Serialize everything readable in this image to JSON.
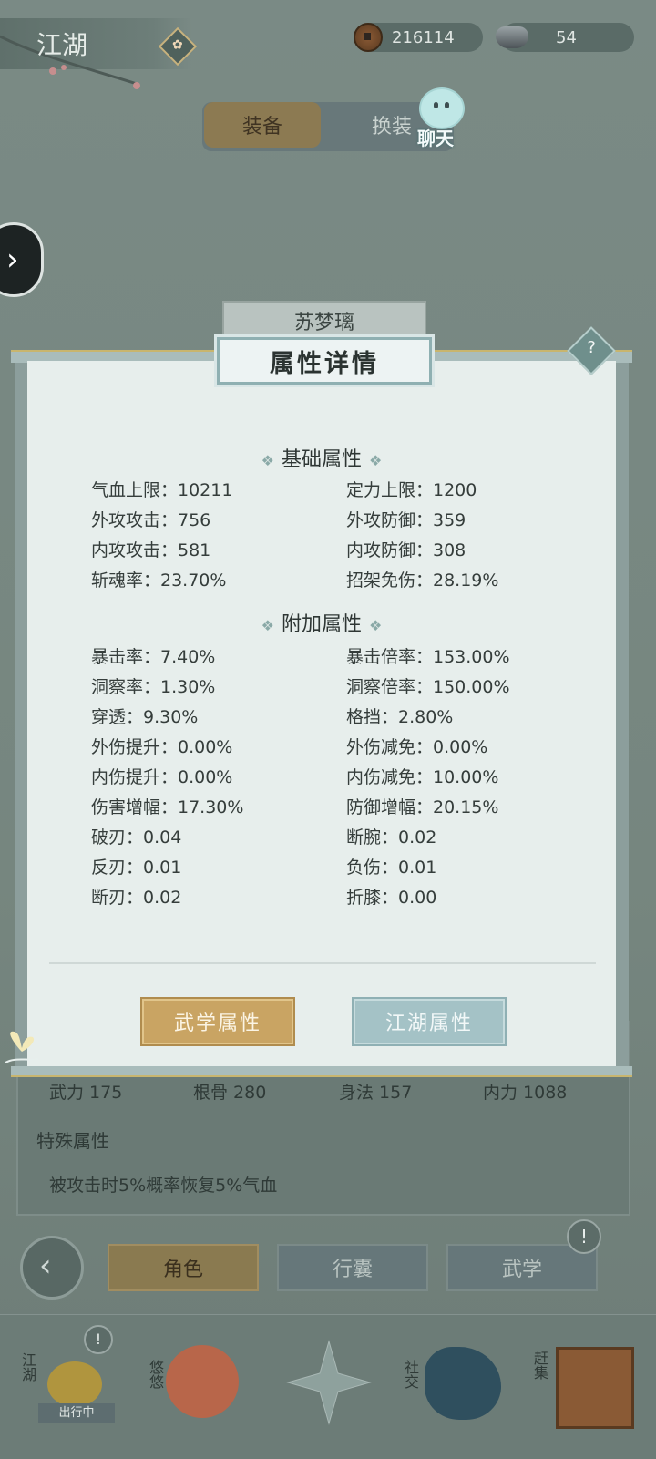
{
  "header": {
    "title": "江湖",
    "hint_icon": "hint-diamond-icon",
    "coins": "216114",
    "ingots": "54"
  },
  "top_tabs": {
    "equip": "装备",
    "change_outfit": "换装",
    "chat": "聊天"
  },
  "modal": {
    "character_name": "苏梦璃",
    "title": "属性详情",
    "help": "?",
    "basic": {
      "heading": "基础属性",
      "left": [
        "气血上限：10211",
        "外攻攻击：756",
        "内攻攻击：581",
        "斩魂率：23.70%"
      ],
      "right": [
        "定力上限：1200",
        "外攻防御：359",
        "内攻防御：308",
        "招架免伤：28.19%"
      ]
    },
    "extra": {
      "heading": "附加属性",
      "left": [
        "暴击率：7.40%",
        "洞察率：1.30%",
        "穿透：9.30%",
        "外伤提升：0.00%",
        "内伤提升：0.00%",
        "伤害增幅：17.30%",
        "破刃：0.04",
        "反刃：0.01",
        "断刃：0.02"
      ],
      "right": [
        "暴击倍率：153.00%",
        "洞察倍率：150.00%",
        "格挡：2.80%",
        "外伤减免：0.00%",
        "内伤减免：10.00%",
        "防御增幅：20.15%",
        "断腕：0.02",
        "负伤：0.01",
        "折膝：0.00"
      ]
    },
    "buttons": {
      "martial": "武学属性",
      "jianghu": "江湖属性"
    }
  },
  "under_panel": {
    "stats": [
      "武力 175",
      "根骨 280",
      "身法 157",
      "内力 1088"
    ],
    "special_heading": "特殊属性",
    "special_desc": "被攻击时5%概率恢复5%气血"
  },
  "bottom_tabs": {
    "back": "‹",
    "role": "角色",
    "bag": "行囊",
    "martial": "武学",
    "alert": "!"
  },
  "dock": {
    "jianghu": "江湖",
    "traveling": "出行中",
    "leisure": "悠悠",
    "social": "社交",
    "market": "赶集",
    "alert": "!"
  }
}
